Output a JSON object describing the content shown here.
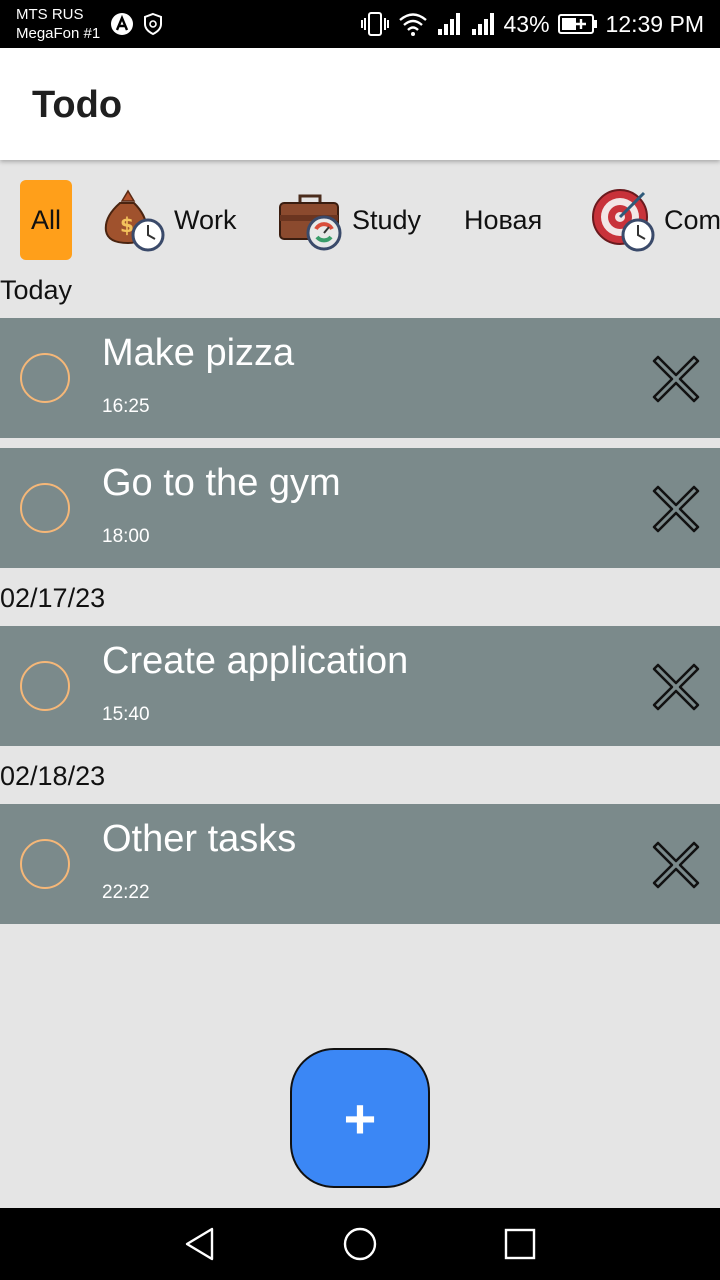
{
  "status_bar": {
    "carrier1": "MTS RUS",
    "carrier2": "MegaFon #1",
    "battery": "43%",
    "time": "12:39 PM"
  },
  "app_bar": {
    "title": "Todo"
  },
  "categories": [
    {
      "label": "All",
      "selected": true
    },
    {
      "label": "Work",
      "icon": "money-bag-clock-icon"
    },
    {
      "label": "Study",
      "icon": "briefcase-clock-icon"
    },
    {
      "label": "Новая"
    },
    {
      "label": "Com",
      "icon": "target-clock-icon"
    }
  ],
  "sections": [
    {
      "label": "Today",
      "tasks": [
        {
          "title": "Make pizza",
          "time": "16:25"
        },
        {
          "title": "Go to the gym",
          "time": "18:00"
        }
      ]
    },
    {
      "label": "02/17/23",
      "tasks": [
        {
          "title": "Create application",
          "time": "15:40"
        }
      ]
    },
    {
      "label": "02/18/23",
      "tasks": [
        {
          "title": "Other tasks",
          "time": "22:22"
        }
      ]
    }
  ],
  "fab": {
    "label": "+"
  },
  "colors": {
    "accent": "#ff9f1a",
    "task_bg": "#7b8a8b",
    "fab": "#3b87f5",
    "circle": "#f5b778"
  }
}
